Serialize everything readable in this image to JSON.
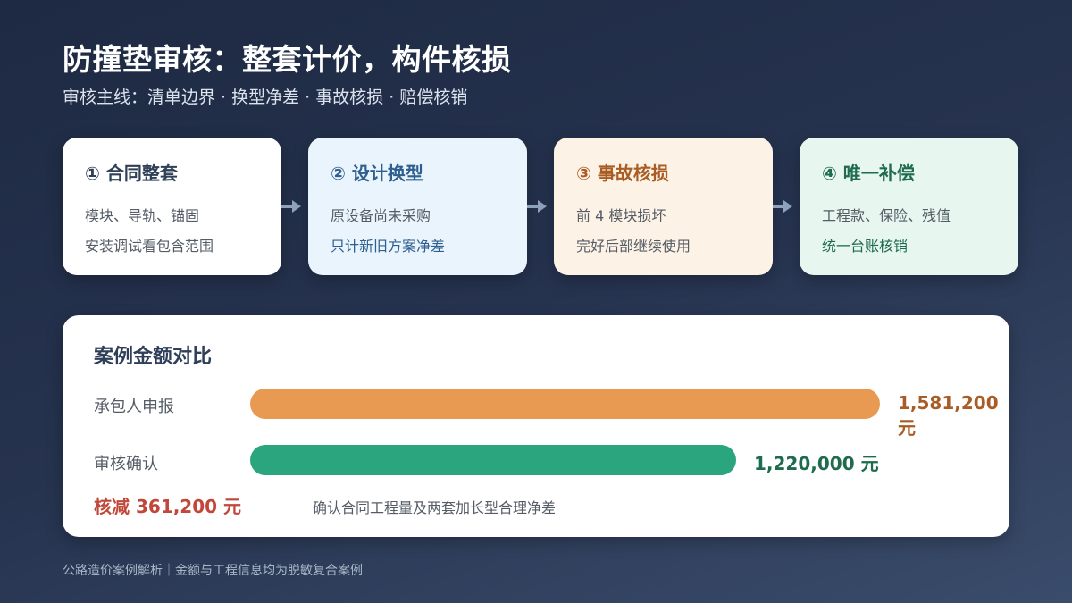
{
  "header": {
    "title": "防撞垫审核：整套计价，构件核损",
    "subtitle": "审核主线：清单边界 · 换型净差 · 事故核损 · 赔偿核销"
  },
  "steps": [
    {
      "title": "① 合同整套",
      "line1": "模块、导轨、锚固",
      "line2": "安装调试看包含范围"
    },
    {
      "title": "② 设计换型",
      "line1": "原设备尚未采购",
      "line2": "只计新旧方案净差"
    },
    {
      "title": "③ 事故核损",
      "line1": "前 4 模块损坏",
      "line2": "完好后部继续使用"
    },
    {
      "title": "④ 唯一补偿",
      "line1": "工程款、保险、残值",
      "line2": "统一台账核销"
    }
  ],
  "comparison": {
    "title": "案例金额对比",
    "rows": [
      {
        "label": "承包人申报",
        "amount": 1581200,
        "amount_text": "1,581,200 元",
        "color": "#e89a52",
        "text_color": "#a95c24"
      },
      {
        "label": "审核确认",
        "amount": 1220000,
        "amount_text": "1,220,000 元",
        "color": "#2aa57e",
        "text_color": "#1e6b4d"
      }
    ],
    "reduction": "核减 361,200 元",
    "note": "确认合同工程量及两套加长型合理净差"
  },
  "footer": "公路造价案例解析｜金额与工程信息均为脱敏复合案例",
  "colors": {
    "arrow": "#8fa3bd",
    "reduction": "#c0473a"
  }
}
